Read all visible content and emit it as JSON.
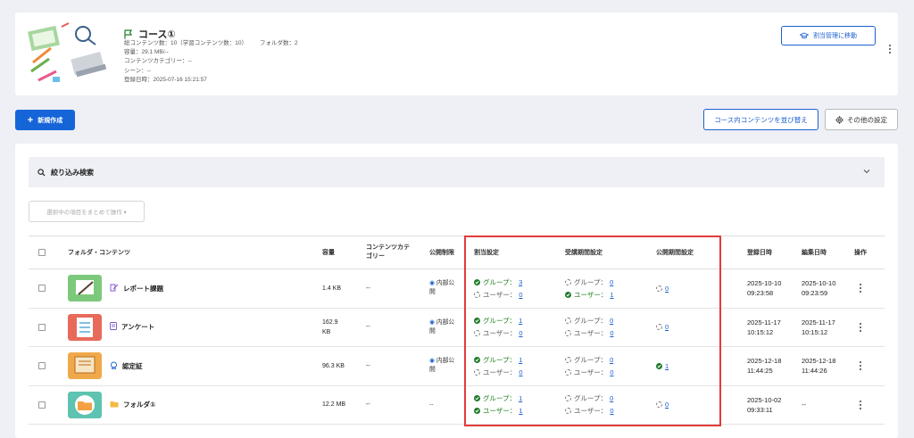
{
  "course": {
    "title": "コース①",
    "total_contents": "総コンテンツ数：10（学習コンテンツ数：10）",
    "folders": "フォルダ数：2",
    "capacity": "容量：29.1 MB/--",
    "category": "コンテンツカテゴリー：--",
    "scene": "シーン：--",
    "registered": "登録日時：2025-07-16 15:21:57",
    "assign_button": "割当管理に移動"
  },
  "toolbar": {
    "new_button": "新規作成",
    "sort_button": "コース内コンテンツを並び替え",
    "other_button": "その他の設定"
  },
  "filter": {
    "label": "絞り込み検索",
    "bulk_button": "選択中の項目をまとめて操作 ▾"
  },
  "table": {
    "headers": {
      "folder_content": "フォルダ・コンテンツ",
      "capacity": "容量",
      "category_l1": "コンテンツカテ",
      "category_l2": "ゴリー",
      "public": "公開制限",
      "assign": "割当設定",
      "attend": "受講期間設定",
      "publish": "公開期間設定",
      "created": "登録日時",
      "edited": "編集日時",
      "ops": "操作"
    },
    "rows": [
      {
        "name": "レポート課題",
        "capacity": "1.4 KB",
        "capacity2": "",
        "category": "--",
        "public1": "内部公",
        "public2": "開",
        "assign_group_label": "グループ：",
        "assign_group": "3",
        "assign_group_ok": true,
        "assign_user_label": "ユーザー：",
        "assign_user": "0",
        "assign_user_ok": false,
        "attend_group_label": "グループ：",
        "attend_group": "0",
        "attend_group_ok": false,
        "attend_user_label": "ユーザー：",
        "attend_user": "1",
        "attend_user_ok": true,
        "publish": "0",
        "publish_ok": false,
        "created1": "2025-10-10",
        "created2": "09:23:58",
        "edited1": "2025-10-10",
        "edited2": "09:23:59",
        "thumb_color": "#7dc97b"
      },
      {
        "name": "アンケート",
        "capacity": "162.9",
        "capacity2": "KB",
        "category": "--",
        "public1": "内部公",
        "public2": "開",
        "assign_group_label": "グループ：",
        "assign_group": "1",
        "assign_group_ok": true,
        "assign_user_label": "ユーザー：",
        "assign_user": "0",
        "assign_user_ok": false,
        "attend_group_label": "グループ：",
        "attend_group": "0",
        "attend_group_ok": false,
        "attend_user_label": "ユーザー：",
        "attend_user": "0",
        "attend_user_ok": false,
        "publish": "0",
        "publish_ok": false,
        "created1": "2025-11-17",
        "created2": "10:15:12",
        "edited1": "2025-11-17",
        "edited2": "10:15:12",
        "thumb_color": "#e86a5a"
      },
      {
        "name": "認定証",
        "capacity": "96.3 KB",
        "capacity2": "",
        "category": "--",
        "public1": "内部公",
        "public2": "開",
        "assign_group_label": "グループ：",
        "assign_group": "1",
        "assign_group_ok": true,
        "assign_user_label": "ユーザー：",
        "assign_user": "0",
        "assign_user_ok": false,
        "attend_group_label": "グループ：",
        "attend_group": "0",
        "attend_group_ok": false,
        "attend_user_label": "ユーザー：",
        "attend_user": "0",
        "attend_user_ok": false,
        "publish": "1",
        "publish_ok": true,
        "created1": "2025-12-18",
        "created2": "11:44:25",
        "edited1": "2025-12-18",
        "edited2": "11:44:26",
        "thumb_color": "#f0a94a"
      },
      {
        "name": "フォルダ①",
        "capacity": "12.2 MB",
        "capacity2": "",
        "category": "--",
        "public1": "--",
        "public2": "",
        "assign_group_label": "グループ：",
        "assign_group": "1",
        "assign_group_ok": true,
        "assign_user_label": "ユーザー：",
        "assign_user": "1",
        "assign_user_ok": true,
        "attend_group_label": "グループ：",
        "attend_group": "0",
        "attend_group_ok": false,
        "attend_user_label": "ユーザー：",
        "attend_user": "0",
        "attend_user_ok": false,
        "publish": "0",
        "publish_ok": false,
        "created1": "2025-10-02",
        "created2": "09:33:11",
        "edited1": "--",
        "edited2": "",
        "thumb_color": "#5ec3b0"
      }
    ]
  },
  "colors": {
    "primary": "#1565d8",
    "ok": "#1f7a2a",
    "highlight": "#e23b3b"
  }
}
